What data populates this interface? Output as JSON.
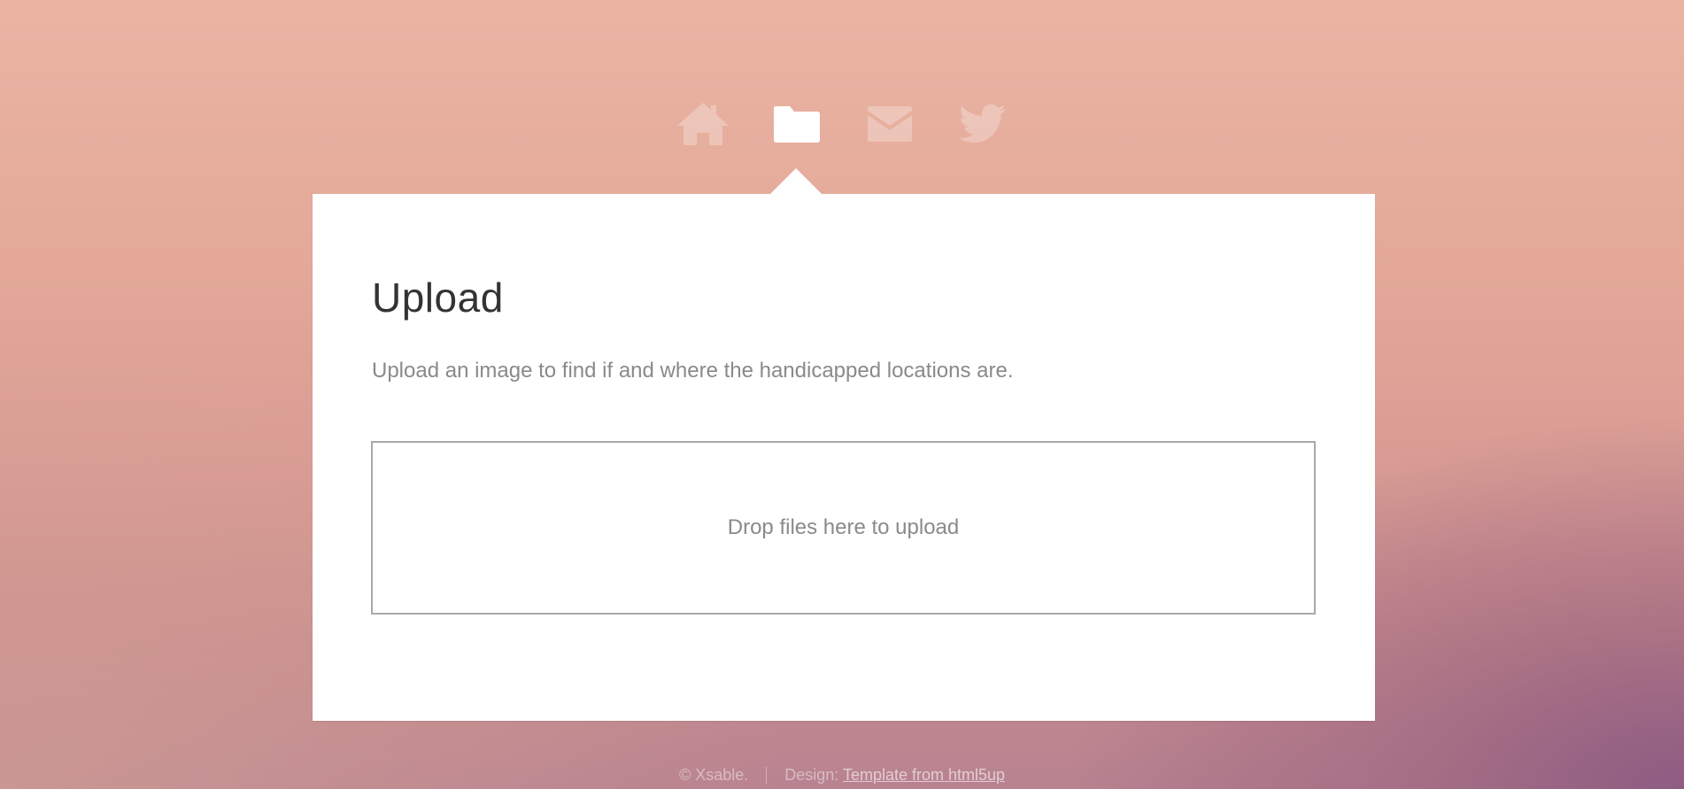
{
  "nav": {
    "items": [
      {
        "icon": "home-icon",
        "active": false
      },
      {
        "icon": "folder-icon",
        "active": true
      },
      {
        "icon": "envelope-icon",
        "active": false
      },
      {
        "icon": "twitter-icon",
        "active": false
      }
    ]
  },
  "main": {
    "title": "Upload",
    "description": "Upload an image to find if and where the handicapped locations are.",
    "dropzone_text": "Drop files here to upload"
  },
  "footer": {
    "copyright": "© Xsable.",
    "design_label": "Design:",
    "design_link": "Template from html5up"
  },
  "colors": {
    "panel": "#ffffff",
    "title": "#333333",
    "body_text": "#8a8a8a",
    "dropzone_border": "#a9a9a9",
    "background_top": "#eab4a3",
    "background_bottom_right": "#8c5a82"
  }
}
